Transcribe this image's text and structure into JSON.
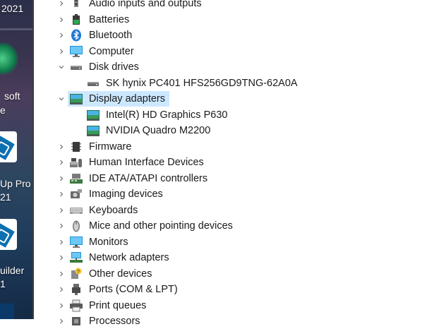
{
  "desktop": {
    "labels": [
      "2021",
      "soft",
      "e",
      "Up Pro",
      "21",
      "uilder",
      "1"
    ]
  },
  "tree": {
    "items": [
      {
        "label": "Audio inputs and outputs",
        "icon": "speaker-icon",
        "level": 1,
        "expanded": false
      },
      {
        "label": "Batteries",
        "icon": "battery-icon",
        "level": 1,
        "expanded": false
      },
      {
        "label": "Bluetooth",
        "icon": "bluetooth-icon",
        "level": 1,
        "expanded": false
      },
      {
        "label": "Computer",
        "icon": "monitor-icon",
        "level": 1,
        "expanded": false
      },
      {
        "label": "Disk drives",
        "icon": "disk-drive-icon",
        "level": 1,
        "expanded": true
      },
      {
        "label": "SK hynix PC401 HFS256GD9TNG-62A0A",
        "icon": "disk-drive-icon",
        "level": 2
      },
      {
        "label": "Display adapters",
        "icon": "display-adapter-icon",
        "level": 1,
        "expanded": true,
        "selected": true
      },
      {
        "label": "Intel(R) HD Graphics P630",
        "icon": "display-adapter-icon",
        "level": 2
      },
      {
        "label": "NVIDIA Quadro M2200",
        "icon": "display-adapter-icon",
        "level": 2
      },
      {
        "label": "Firmware",
        "icon": "firmware-icon",
        "level": 1,
        "expanded": false
      },
      {
        "label": "Human Interface Devices",
        "icon": "hid-icon",
        "level": 1,
        "expanded": false
      },
      {
        "label": "IDE ATA/ATAPI controllers",
        "icon": "ide-controller-icon",
        "level": 1,
        "expanded": false
      },
      {
        "label": "Imaging devices",
        "icon": "camera-icon",
        "level": 1,
        "expanded": false
      },
      {
        "label": "Keyboards",
        "icon": "keyboard-icon",
        "level": 1,
        "expanded": false
      },
      {
        "label": "Mice and other pointing devices",
        "icon": "mouse-icon",
        "level": 1,
        "expanded": false
      },
      {
        "label": "Monitors",
        "icon": "monitor-icon",
        "level": 1,
        "expanded": false
      },
      {
        "label": "Network adapters",
        "icon": "network-adapter-icon",
        "level": 1,
        "expanded": false
      },
      {
        "label": "Other devices",
        "icon": "unknown-device-icon",
        "level": 1,
        "expanded": false
      },
      {
        "label": "Ports (COM & LPT)",
        "icon": "port-icon",
        "level": 1,
        "expanded": false
      },
      {
        "label": "Print queues",
        "icon": "printer-icon",
        "level": 1,
        "expanded": false
      },
      {
        "label": "Processors",
        "icon": "processor-icon",
        "level": 1,
        "expanded": false
      }
    ]
  },
  "colors": {
    "selection": "#cce8ff",
    "text": "#1a1a1a",
    "chevron": "#6b6b6b"
  }
}
